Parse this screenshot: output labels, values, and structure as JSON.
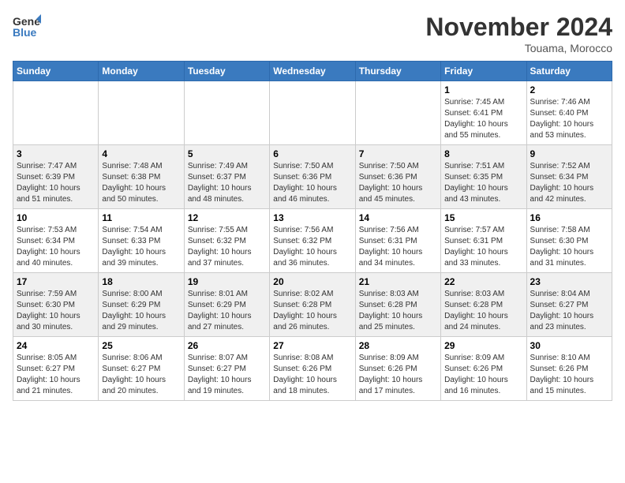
{
  "header": {
    "logo_general": "General",
    "logo_blue": "Blue",
    "month_title": "November 2024",
    "location": "Touama, Morocco"
  },
  "weekdays": [
    "Sunday",
    "Monday",
    "Tuesday",
    "Wednesday",
    "Thursday",
    "Friday",
    "Saturday"
  ],
  "weeks": [
    [
      {
        "day": "",
        "info": ""
      },
      {
        "day": "",
        "info": ""
      },
      {
        "day": "",
        "info": ""
      },
      {
        "day": "",
        "info": ""
      },
      {
        "day": "",
        "info": ""
      },
      {
        "day": "1",
        "info": "Sunrise: 7:45 AM\nSunset: 6:41 PM\nDaylight: 10 hours and 55 minutes."
      },
      {
        "day": "2",
        "info": "Sunrise: 7:46 AM\nSunset: 6:40 PM\nDaylight: 10 hours and 53 minutes."
      }
    ],
    [
      {
        "day": "3",
        "info": "Sunrise: 7:47 AM\nSunset: 6:39 PM\nDaylight: 10 hours and 51 minutes."
      },
      {
        "day": "4",
        "info": "Sunrise: 7:48 AM\nSunset: 6:38 PM\nDaylight: 10 hours and 50 minutes."
      },
      {
        "day": "5",
        "info": "Sunrise: 7:49 AM\nSunset: 6:37 PM\nDaylight: 10 hours and 48 minutes."
      },
      {
        "day": "6",
        "info": "Sunrise: 7:50 AM\nSunset: 6:36 PM\nDaylight: 10 hours and 46 minutes."
      },
      {
        "day": "7",
        "info": "Sunrise: 7:50 AM\nSunset: 6:36 PM\nDaylight: 10 hours and 45 minutes."
      },
      {
        "day": "8",
        "info": "Sunrise: 7:51 AM\nSunset: 6:35 PM\nDaylight: 10 hours and 43 minutes."
      },
      {
        "day": "9",
        "info": "Sunrise: 7:52 AM\nSunset: 6:34 PM\nDaylight: 10 hours and 42 minutes."
      }
    ],
    [
      {
        "day": "10",
        "info": "Sunrise: 7:53 AM\nSunset: 6:34 PM\nDaylight: 10 hours and 40 minutes."
      },
      {
        "day": "11",
        "info": "Sunrise: 7:54 AM\nSunset: 6:33 PM\nDaylight: 10 hours and 39 minutes."
      },
      {
        "day": "12",
        "info": "Sunrise: 7:55 AM\nSunset: 6:32 PM\nDaylight: 10 hours and 37 minutes."
      },
      {
        "day": "13",
        "info": "Sunrise: 7:56 AM\nSunset: 6:32 PM\nDaylight: 10 hours and 36 minutes."
      },
      {
        "day": "14",
        "info": "Sunrise: 7:56 AM\nSunset: 6:31 PM\nDaylight: 10 hours and 34 minutes."
      },
      {
        "day": "15",
        "info": "Sunrise: 7:57 AM\nSunset: 6:31 PM\nDaylight: 10 hours and 33 minutes."
      },
      {
        "day": "16",
        "info": "Sunrise: 7:58 AM\nSunset: 6:30 PM\nDaylight: 10 hours and 31 minutes."
      }
    ],
    [
      {
        "day": "17",
        "info": "Sunrise: 7:59 AM\nSunset: 6:30 PM\nDaylight: 10 hours and 30 minutes."
      },
      {
        "day": "18",
        "info": "Sunrise: 8:00 AM\nSunset: 6:29 PM\nDaylight: 10 hours and 29 minutes."
      },
      {
        "day": "19",
        "info": "Sunrise: 8:01 AM\nSunset: 6:29 PM\nDaylight: 10 hours and 27 minutes."
      },
      {
        "day": "20",
        "info": "Sunrise: 8:02 AM\nSunset: 6:28 PM\nDaylight: 10 hours and 26 minutes."
      },
      {
        "day": "21",
        "info": "Sunrise: 8:03 AM\nSunset: 6:28 PM\nDaylight: 10 hours and 25 minutes."
      },
      {
        "day": "22",
        "info": "Sunrise: 8:03 AM\nSunset: 6:28 PM\nDaylight: 10 hours and 24 minutes."
      },
      {
        "day": "23",
        "info": "Sunrise: 8:04 AM\nSunset: 6:27 PM\nDaylight: 10 hours and 23 minutes."
      }
    ],
    [
      {
        "day": "24",
        "info": "Sunrise: 8:05 AM\nSunset: 6:27 PM\nDaylight: 10 hours and 21 minutes."
      },
      {
        "day": "25",
        "info": "Sunrise: 8:06 AM\nSunset: 6:27 PM\nDaylight: 10 hours and 20 minutes."
      },
      {
        "day": "26",
        "info": "Sunrise: 8:07 AM\nSunset: 6:27 PM\nDaylight: 10 hours and 19 minutes."
      },
      {
        "day": "27",
        "info": "Sunrise: 8:08 AM\nSunset: 6:26 PM\nDaylight: 10 hours and 18 minutes."
      },
      {
        "day": "28",
        "info": "Sunrise: 8:09 AM\nSunset: 6:26 PM\nDaylight: 10 hours and 17 minutes."
      },
      {
        "day": "29",
        "info": "Sunrise: 8:09 AM\nSunset: 6:26 PM\nDaylight: 10 hours and 16 minutes."
      },
      {
        "day": "30",
        "info": "Sunrise: 8:10 AM\nSunset: 6:26 PM\nDaylight: 10 hours and 15 minutes."
      }
    ]
  ]
}
